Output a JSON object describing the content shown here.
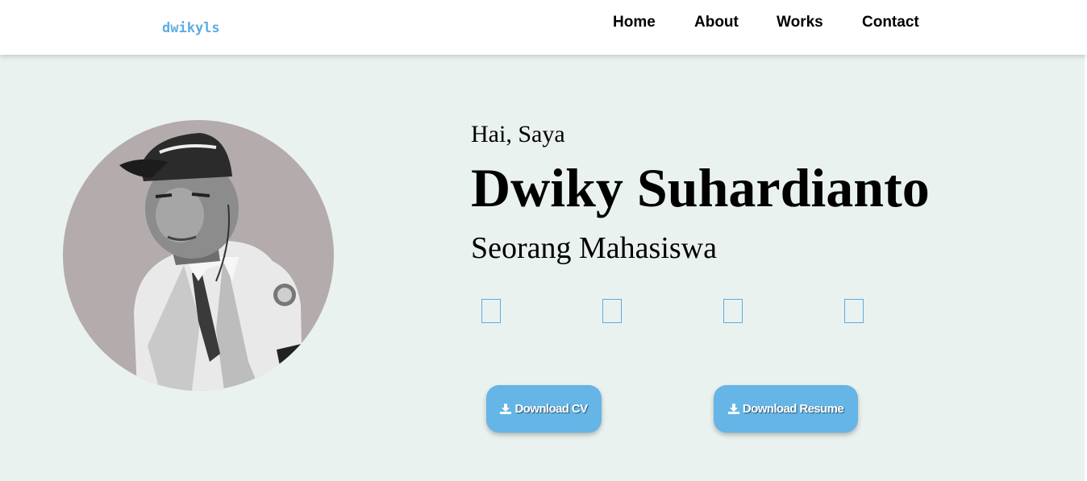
{
  "brand": "dwikyls",
  "nav": {
    "home": "Home",
    "about": "About",
    "works": "Works",
    "contact": "Contact"
  },
  "hero": {
    "greeting": "Hai, Saya",
    "name": "Dwiky Suhardianto",
    "role": "Seorang Mahasiswa",
    "avatar_alt": "profile-photo",
    "social_icons": [
      "social-icon",
      "social-icon",
      "social-icon",
      "social-icon"
    ],
    "buttons": {
      "cv_label": "Download CV",
      "resume_label": "Download Resume",
      "icon": "download-icon"
    }
  },
  "colors": {
    "accent": "#5dade2",
    "button": "#65b5e6",
    "background": "#eaf2ef",
    "avatar_bg": "#b3abac"
  }
}
